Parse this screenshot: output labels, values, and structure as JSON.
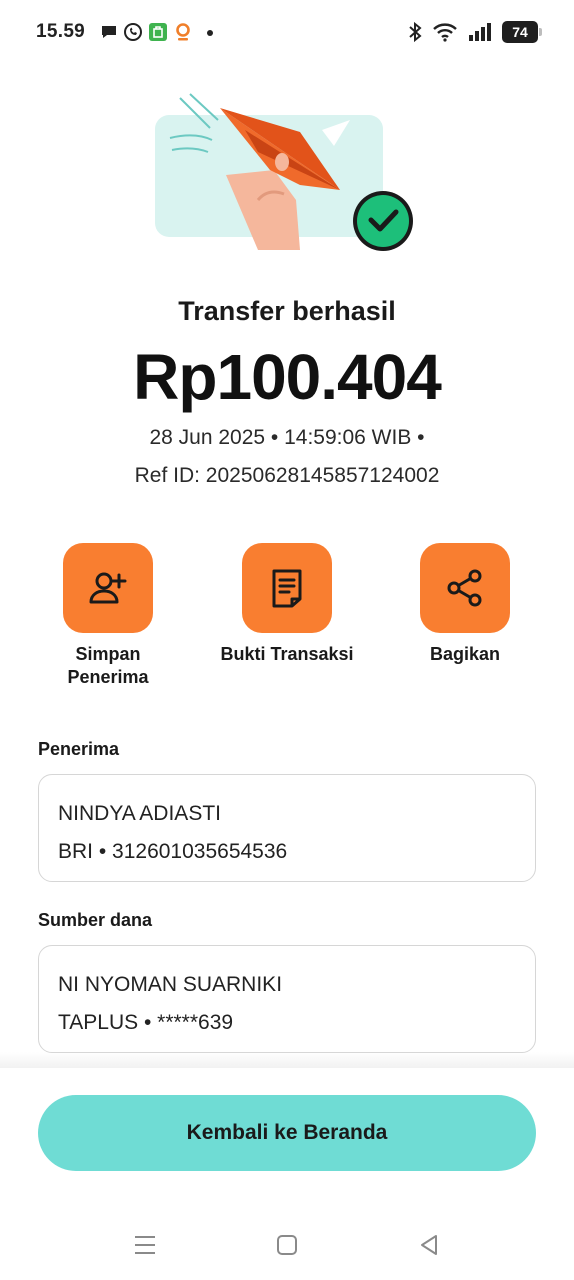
{
  "status_bar": {
    "time": "15.59",
    "battery": "74",
    "icons": [
      "chat-bubble-icon",
      "whatsapp-icon",
      "shopping-bag-icon",
      "location-pin-icon",
      "dot-icon",
      "bluetooth-icon",
      "wifi-icon",
      "signal-icon",
      "battery-icon"
    ]
  },
  "receipt": {
    "title": "Transfer berhasil",
    "amount": "Rp100.404",
    "datetime": "28 Jun 2025 • 14:59:06 WIB •",
    "ref": "Ref ID: 20250628145857124002"
  },
  "actions": [
    {
      "label_line1": "Simpan",
      "label_line2": "Penerima",
      "icon": "add-user-icon"
    },
    {
      "label_line1": "Bukti Transaksi",
      "label_line2": "",
      "icon": "receipt-document-icon"
    },
    {
      "label_line1": "Bagikan",
      "label_line2": "",
      "icon": "share-icon"
    }
  ],
  "recipient": {
    "label": "Penerima",
    "name": "NINDYA ADIASTI",
    "account": "BRI • 312601035654536"
  },
  "source": {
    "label": "Sumber dana",
    "name": "NI NYOMAN SUARNIKI",
    "account": "TAPLUS • *****639"
  },
  "footer": {
    "back_button": "Kembali ke Beranda"
  },
  "colors": {
    "accent_orange": "#f97e30",
    "teal_button": "#6fdcd4",
    "success_green": "#1dbf7a"
  }
}
